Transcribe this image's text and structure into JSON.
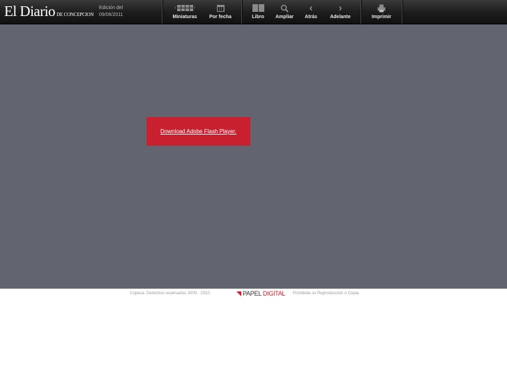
{
  "header": {
    "logo_main": "El Diario",
    "logo_sub": "DE CONCEPCION",
    "edition_label": "Edición del",
    "edition_date": "09/06/2011"
  },
  "nav": {
    "miniaturas": "Miniaturas",
    "por_fecha": "Por fecha",
    "libro": "Libro",
    "ampliar": "Ampliar",
    "atras": "Atrás",
    "adelante": "Adelante",
    "imprimir": "Imprimir"
  },
  "stage": {
    "flash_link": "Download Adobe Flash Player."
  },
  "footer": {
    "copyright": "Copesa. Derechos reservados 2009 - 2010.",
    "brand_papel": "PAPEL",
    "brand_digital": "DIGITAL",
    "notice": "Prohibida su Reproducción o Copia."
  },
  "colors": {
    "stage_bg": "#62646f",
    "accent_red": "#c8202f",
    "topbar_bg": "#1e1e1e"
  }
}
